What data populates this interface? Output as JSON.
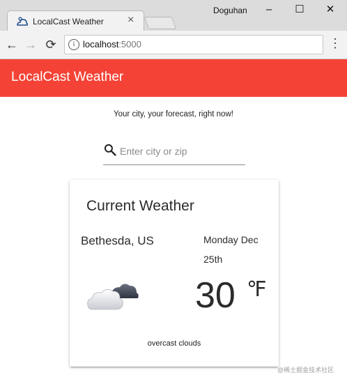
{
  "browser": {
    "tab_title": "LocalCast Weather",
    "user_name": "Doguhan",
    "url_host": "localhost",
    "url_port": ":5000",
    "controls": {
      "minimize": "–",
      "maximize": "☐",
      "close": "✕"
    },
    "nav": {
      "back": "←",
      "forward": "→",
      "reload": "⟳",
      "menu": "⋮"
    }
  },
  "app": {
    "title": "LocalCast Weather",
    "accent_color": "#f44336",
    "tagline": "Your city, your forecast, right now!",
    "search": {
      "placeholder": "Enter city or zip",
      "value": ""
    }
  },
  "current_weather": {
    "title": "Current Weather",
    "city": "Bethesda, US",
    "date_line1": "Monday Dec",
    "date_line2": "25th",
    "temperature": "30",
    "unit": "℉",
    "icon": "overcast-clouds-icon",
    "description": "overcast clouds"
  },
  "watermark": "@稀土掘金技术社区"
}
